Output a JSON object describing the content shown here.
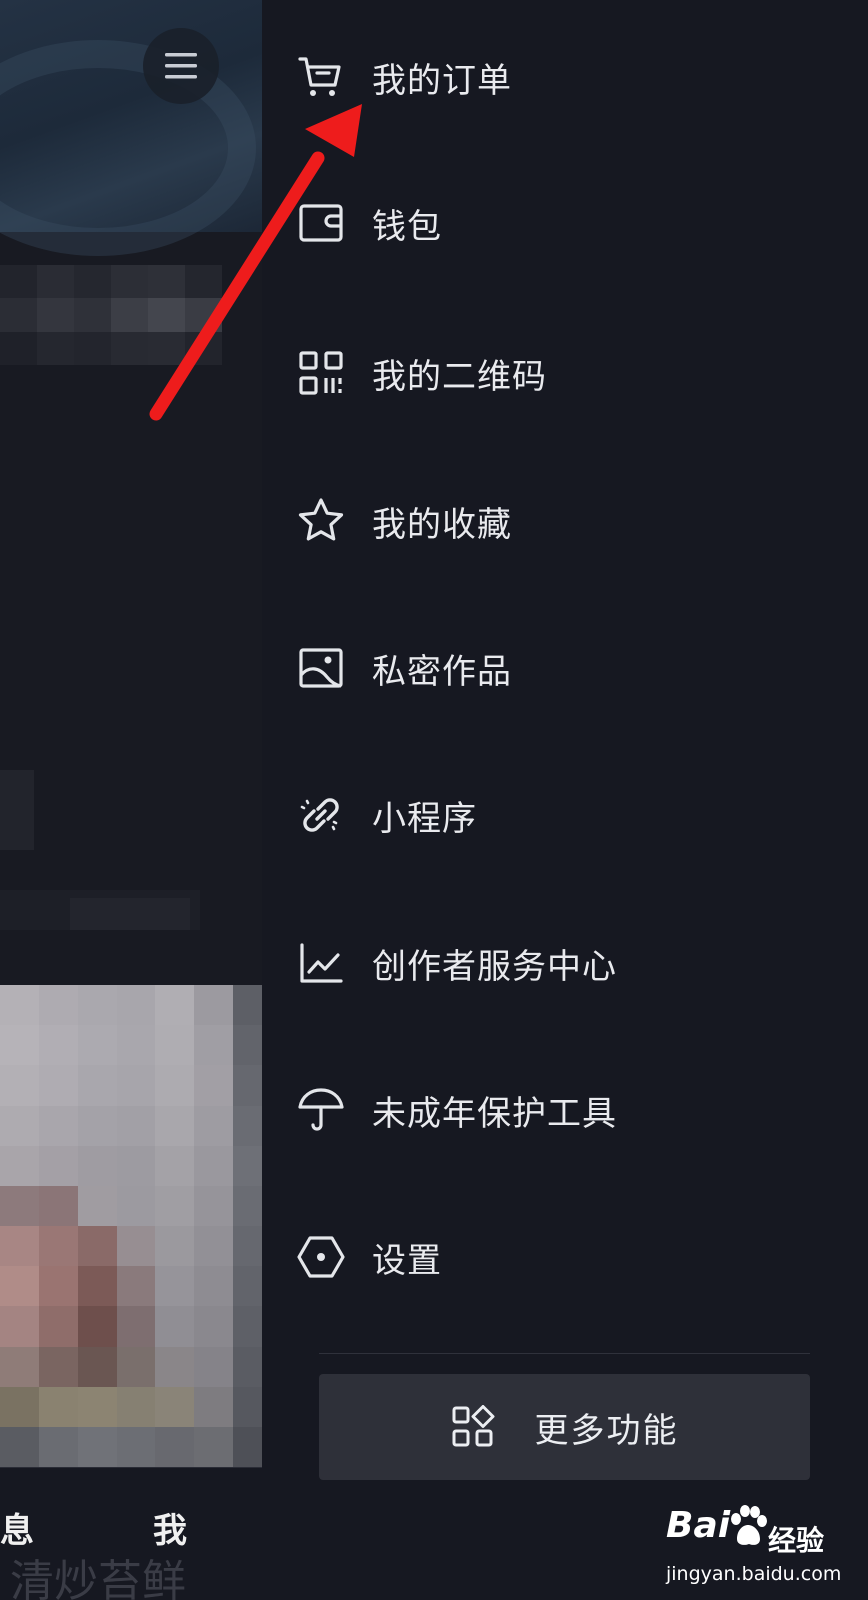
{
  "drawer": {
    "items": [
      {
        "label": "我的订单",
        "icon": "cart-icon"
      },
      {
        "label": "钱包",
        "icon": "wallet-icon"
      },
      {
        "label": "我的二维码",
        "icon": "qr-code-icon"
      },
      {
        "label": "我的收藏",
        "icon": "star-icon"
      },
      {
        "label": "私密作品",
        "icon": "image-icon"
      },
      {
        "label": "小程序",
        "icon": "link-icon"
      },
      {
        "label": "创作者服务中心",
        "icon": "chart-icon"
      },
      {
        "label": "未成年保护工具",
        "icon": "umbrella-icon"
      },
      {
        "label": "设置",
        "icon": "hexagon-settings-icon"
      }
    ],
    "more_button": {
      "label": "更多功能",
      "icon": "apps-icon"
    }
  },
  "background": {
    "tab_labels": {
      "message_partial": "息",
      "me": "我"
    },
    "ghost_text": "清炒苔鲜"
  },
  "watermark": {
    "logo": "Bai  ",
    "jingyan": "经验",
    "url": "jingyan.baidu.com"
  },
  "annotation": {
    "arrow_color": "#ee1c1c"
  },
  "colors": {
    "drawer_bg": "#161821",
    "more_button_bg": "#2e3039",
    "text": "#e9eaee"
  }
}
